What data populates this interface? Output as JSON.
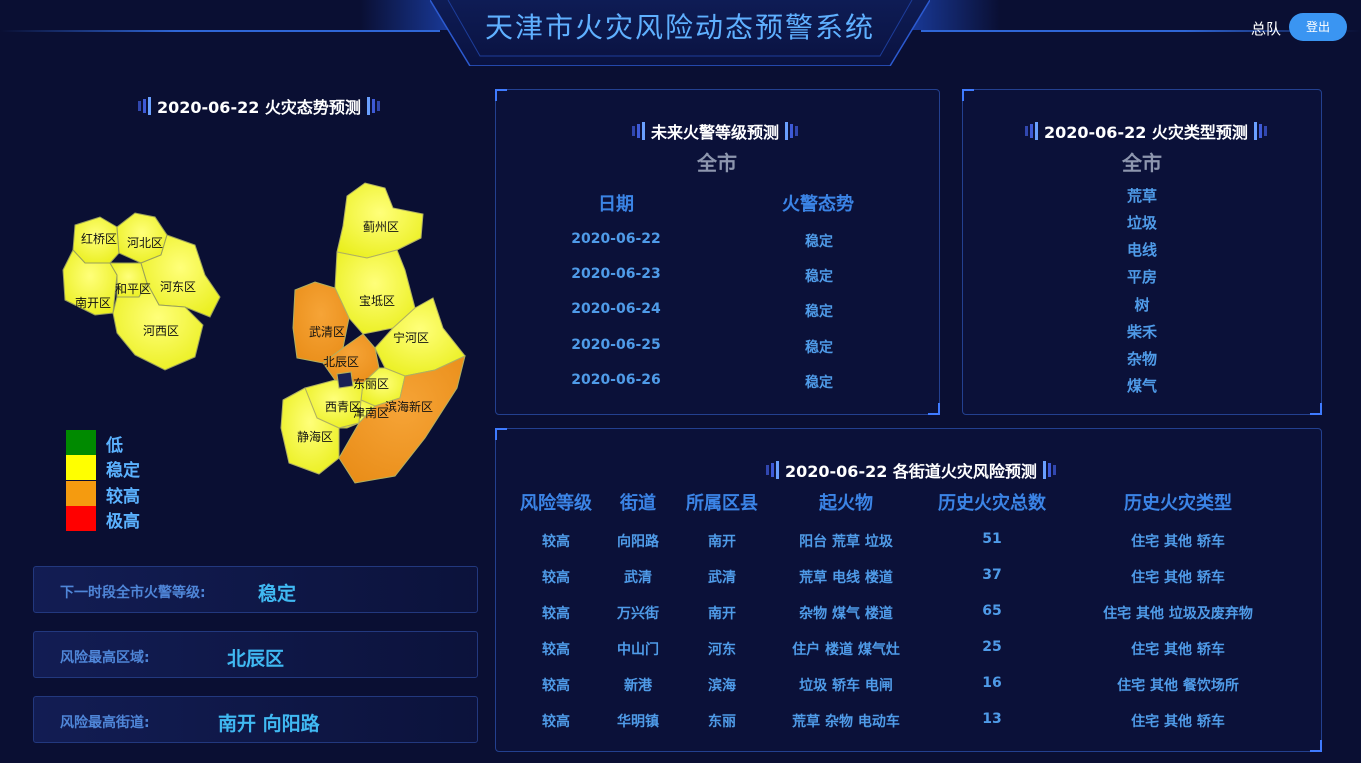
{
  "header": {
    "title": "天津市火灾风险动态预警系统",
    "user": "总队",
    "login_label": "登出"
  },
  "left": {
    "map_title": "2020-06-22 火灾态势预测",
    "legend": [
      {
        "label": "低",
        "color": "#008a00"
      },
      {
        "label": "稳定",
        "color": "#ffff00"
      },
      {
        "label": "较高",
        "color": "#f59b0f"
      },
      {
        "label": "极高",
        "color": "#ff0000"
      }
    ],
    "urban_districts": [
      "红桥区",
      "河北区",
      "南开区",
      "和平区",
      "河东区",
      "河西区"
    ],
    "outer_districts": [
      "蓟州区",
      "宝坻区",
      "武清区",
      "宁河区",
      "北辰区",
      "东丽区",
      "西青区",
      "滨海新区",
      "津南区",
      "静海区"
    ],
    "info": [
      {
        "label": "下一时段全市火警等级:",
        "value": "稳定"
      },
      {
        "label": "风险最高区域:",
        "value": "北辰区"
      },
      {
        "label": "风险最高街道:",
        "value": "南开 向阳路"
      }
    ]
  },
  "forecast": {
    "title": "未来火警等级预测",
    "scope": "全市",
    "col_date": "日期",
    "col_trend": "火警态势",
    "rows": [
      {
        "date": "2020-06-22",
        "trend": "稳定"
      },
      {
        "date": "2020-06-23",
        "trend": "稳定"
      },
      {
        "date": "2020-06-24",
        "trend": "稳定"
      },
      {
        "date": "2020-06-25",
        "trend": "稳定"
      },
      {
        "date": "2020-06-26",
        "trend": "稳定"
      }
    ]
  },
  "types": {
    "title": "2020-06-22 火灾类型预测",
    "scope": "全市",
    "items": [
      "荒草",
      "垃圾",
      "电线",
      "平房",
      "树",
      "柴禾",
      "杂物",
      "煤气"
    ]
  },
  "streets": {
    "title": "2020-06-22 各街道火灾风险预测",
    "headers": [
      "风险等级",
      "街道",
      "所属区县",
      "起火物",
      "历史火灾总数",
      "历史火灾类型"
    ],
    "rows": [
      [
        "较高",
        "向阳路",
        "南开",
        "阳台 荒草 垃圾",
        "51",
        "住宅 其他 轿车"
      ],
      [
        "较高",
        "武清",
        "武清",
        "荒草 电线 楼道",
        "37",
        "住宅 其他 轿车"
      ],
      [
        "较高",
        "万兴街",
        "南开",
        "杂物 煤气 楼道",
        "65",
        "住宅 其他 垃圾及废弃物"
      ],
      [
        "较高",
        "中山门",
        "河东",
        "住户 楼道 煤气灶",
        "25",
        "住宅 其他 轿车"
      ],
      [
        "较高",
        "新港",
        "滨海",
        "垃圾 轿车 电闸",
        "16",
        "住宅 其他 餐饮场所"
      ],
      [
        "较高",
        "华明镇",
        "东丽",
        "荒草 杂物 电动车",
        "13",
        "住宅 其他 轿车"
      ]
    ]
  }
}
